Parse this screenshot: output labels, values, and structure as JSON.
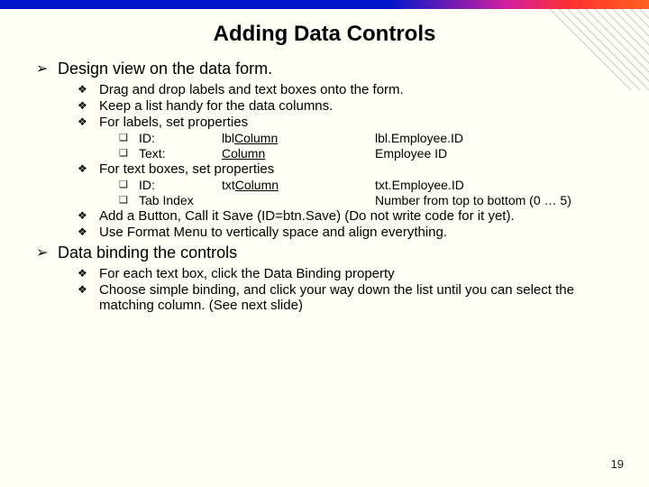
{
  "title": "Adding Data Controls",
  "page_number": "19",
  "sections": [
    {
      "heading": "Design view on the data form.",
      "items": [
        {
          "text": "Drag and drop labels and text boxes onto the form."
        },
        {
          "text": "Keep a list handy for the data columns."
        },
        {
          "text": "For labels, set properties",
          "rows": [
            {
              "label": "ID:",
              "val1": "lbl",
              "val1u": "Column",
              "val2": "lbl.Employee.ID"
            },
            {
              "label": "Text:",
              "val1": "",
              "val1u": "Column",
              "val2": "Employee ID"
            }
          ]
        },
        {
          "text": "For text boxes, set properties",
          "rows": [
            {
              "label": "ID:",
              "val1": "txt",
              "val1u": "Column",
              "val2": "txt.Employee.ID"
            },
            {
              "label": "Tab Index",
              "val1": "",
              "val1u": "",
              "val2": "Number from top to bottom (0 … 5)"
            }
          ]
        },
        {
          "text": "Add a Button, Call it Save (ID=btn.Save) (Do not write code for it yet)."
        },
        {
          "text": "Use Format Menu to vertically space and align everything."
        }
      ]
    },
    {
      "heading": "Data binding the controls",
      "items": [
        {
          "text": "For each text box, click the Data Binding property"
        },
        {
          "text": "Choose simple binding, and click your way down the list until you can select the matching column. (See next slide)"
        }
      ]
    }
  ]
}
